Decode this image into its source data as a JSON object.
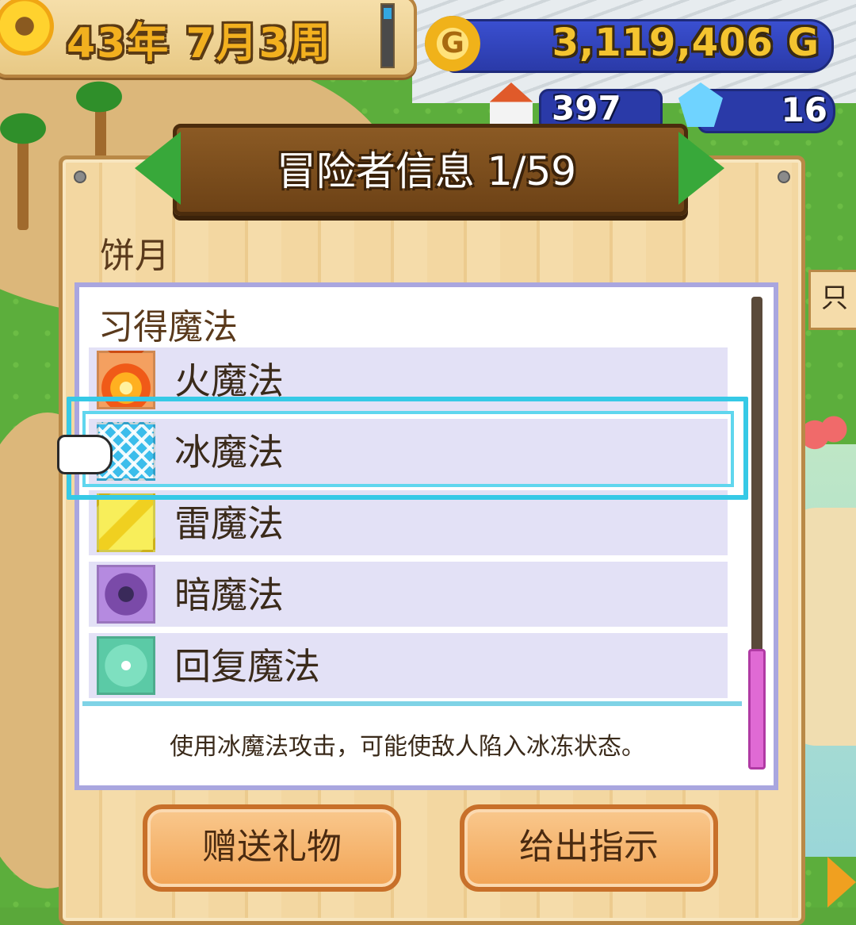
{
  "hud": {
    "date": "43年 7月3周",
    "gold": "3,119,406 G",
    "coin_symbol": "G",
    "population": "397",
    "crystals": "16"
  },
  "dialog": {
    "title": "冒险者信息 1/59",
    "adventurer_name": "饼月",
    "section_header": "习得魔法",
    "magic_list": [
      {
        "label": "火魔法",
        "icon": "fire-icon"
      },
      {
        "label": "冰魔法",
        "icon": "ice-icon",
        "selected": true
      },
      {
        "label": "雷魔法",
        "icon": "thunder-icon"
      },
      {
        "label": "暗魔法",
        "icon": "dark-icon"
      },
      {
        "label": "回复魔法",
        "icon": "heal-icon"
      }
    ],
    "description": "使用冰魔法攻击，可能使敌人陷入冰冻状态。",
    "buttons": {
      "gift": "赠送礼物",
      "command": "给出指示"
    }
  },
  "side": {
    "label": "只"
  },
  "colors": {
    "selection": "#36c9e6",
    "panel_border": "#a9a6df",
    "button": "#f2a455",
    "scroll_thumb": "#e06ad4"
  }
}
